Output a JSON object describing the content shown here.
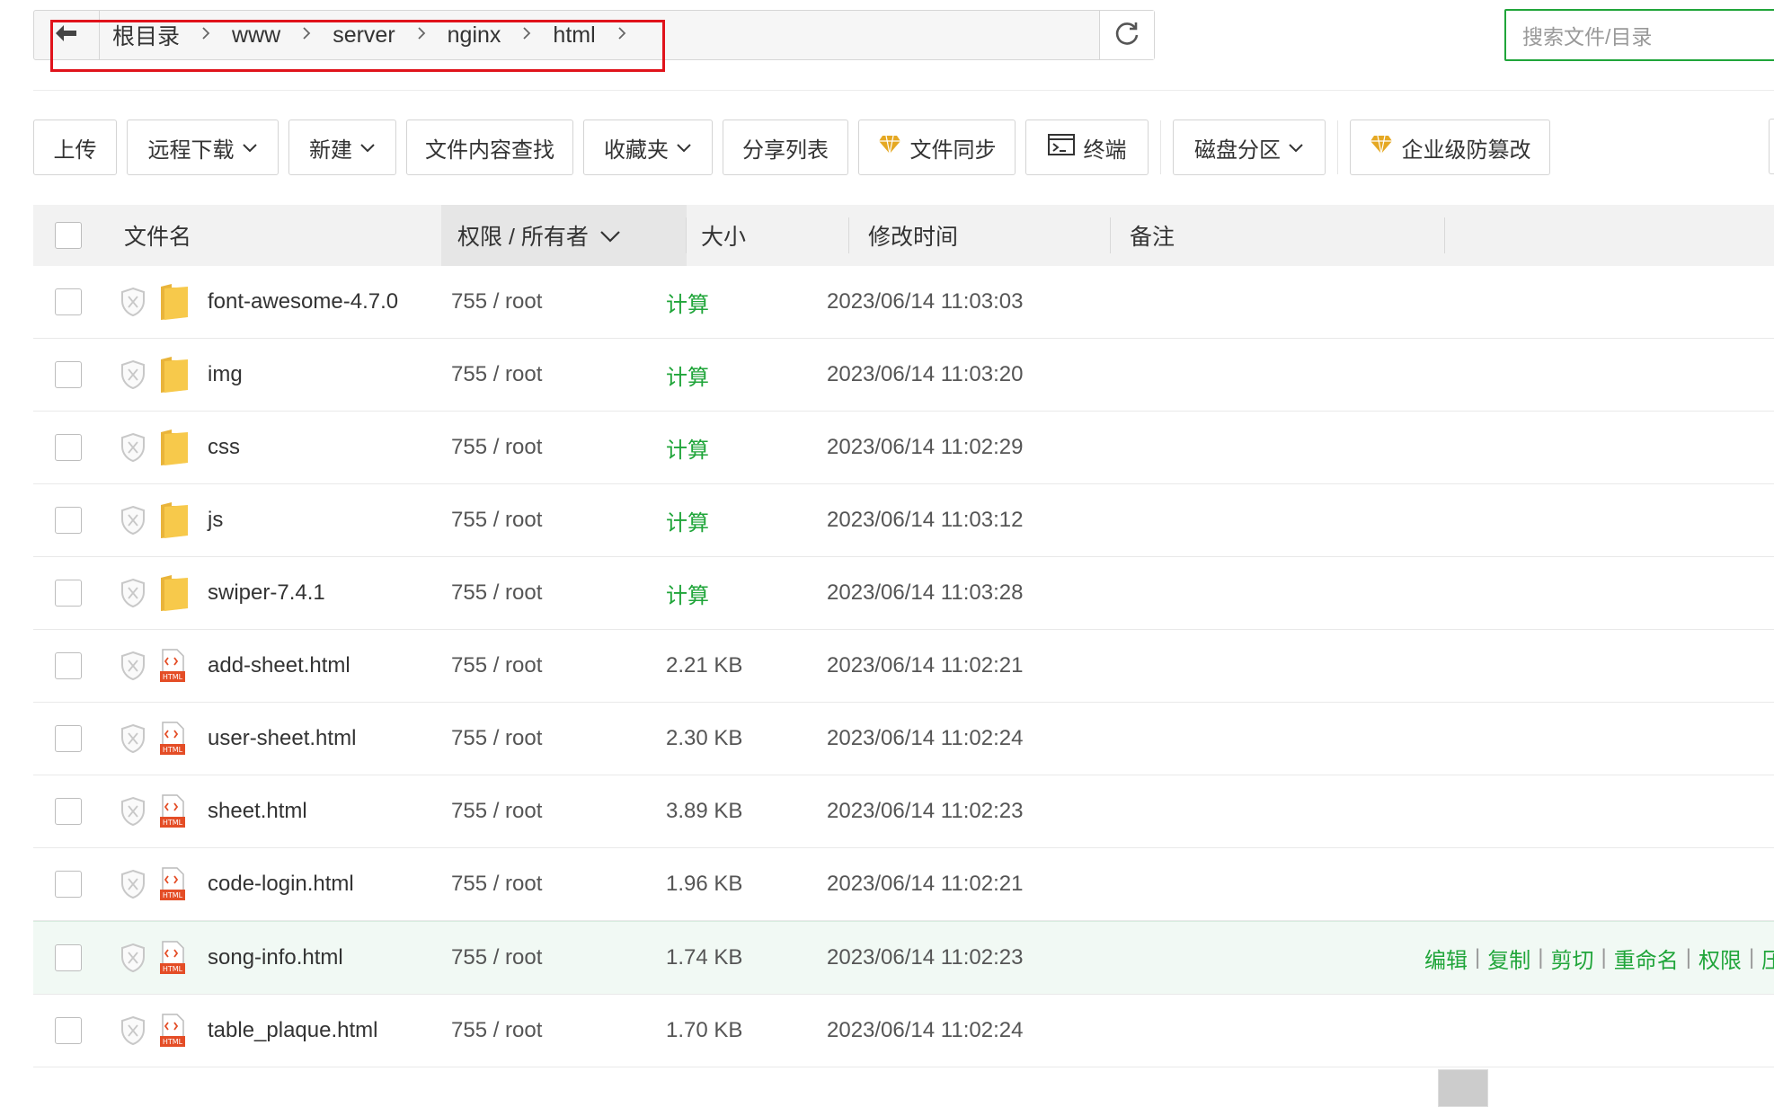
{
  "breadcrumb": {
    "items": [
      "根目录",
      "www",
      "server",
      "nginx",
      "html"
    ]
  },
  "search": {
    "placeholder": "搜索文件/目录"
  },
  "toolbar": {
    "upload": "上传",
    "remote_download": "远程下载",
    "new": "新建",
    "content_search": "文件内容查找",
    "favorites": "收藏夹",
    "share_list": "分享列表",
    "file_sync": "文件同步",
    "terminal": "终端",
    "disk_partition": "磁盘分区",
    "enterprise_tamper": "企业级防篡改"
  },
  "table": {
    "headers": {
      "name": "文件名",
      "permission": "权限 / 所有者",
      "size": "大小",
      "mtime": "修改时间",
      "note": "备注"
    },
    "rows": [
      {
        "name": "font-awesome-4.7.0",
        "type": "folder",
        "perm": "755 / root",
        "size": "计算",
        "size_is_link": true,
        "mtime": "2023/06/14 11:03:03"
      },
      {
        "name": "img",
        "type": "folder",
        "perm": "755 / root",
        "size": "计算",
        "size_is_link": true,
        "mtime": "2023/06/14 11:03:20"
      },
      {
        "name": "css",
        "type": "folder",
        "perm": "755 / root",
        "size": "计算",
        "size_is_link": true,
        "mtime": "2023/06/14 11:02:29"
      },
      {
        "name": "js",
        "type": "folder",
        "perm": "755 / root",
        "size": "计算",
        "size_is_link": true,
        "mtime": "2023/06/14 11:03:12"
      },
      {
        "name": "swiper-7.4.1",
        "type": "folder",
        "perm": "755 / root",
        "size": "计算",
        "size_is_link": true,
        "mtime": "2023/06/14 11:03:28"
      },
      {
        "name": "add-sheet.html",
        "type": "html",
        "perm": "755 / root",
        "size": "2.21 KB",
        "size_is_link": false,
        "mtime": "2023/06/14 11:02:21"
      },
      {
        "name": "user-sheet.html",
        "type": "html",
        "perm": "755 / root",
        "size": "2.30 KB",
        "size_is_link": false,
        "mtime": "2023/06/14 11:02:24"
      },
      {
        "name": "sheet.html",
        "type": "html",
        "perm": "755 / root",
        "size": "3.89 KB",
        "size_is_link": false,
        "mtime": "2023/06/14 11:02:23"
      },
      {
        "name": "code-login.html",
        "type": "html",
        "perm": "755 / root",
        "size": "1.96 KB",
        "size_is_link": false,
        "mtime": "2023/06/14 11:02:21"
      },
      {
        "name": "song-info.html",
        "type": "html",
        "perm": "755 / root",
        "size": "1.74 KB",
        "size_is_link": false,
        "mtime": "2023/06/14 11:02:23",
        "hover": true
      },
      {
        "name": "table_plaque.html",
        "type": "html",
        "perm": "755 / root",
        "size": "1.70 KB",
        "size_is_link": false,
        "mtime": "2023/06/14 11:02:24"
      }
    ],
    "row_actions": [
      "编辑",
      "复制",
      "剪切",
      "重命名",
      "权限",
      "压"
    ]
  },
  "icons": {
    "back": "arrow-left-icon",
    "refresh": "refresh-icon",
    "shield": "shield-icon",
    "folder": "folder-icon",
    "html": "html-file-icon",
    "gem": "gem-icon",
    "terminal": "terminal-icon",
    "chevron": "chevron-down-icon"
  },
  "colors": {
    "accent": "#20a53a",
    "highlight_box": "#e0131b",
    "folder": "#f7c94b",
    "html_icon": "#e44d26",
    "gem": "#e5a823"
  }
}
